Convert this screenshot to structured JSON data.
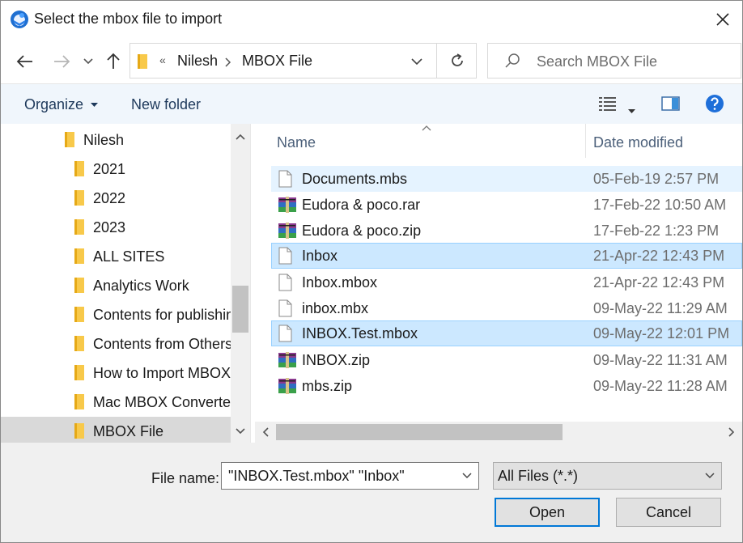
{
  "window": {
    "title": "Select the mbox file to import"
  },
  "address": {
    "overflow": "«",
    "crumbs": [
      "Nilesh",
      "MBOX File"
    ]
  },
  "search": {
    "placeholder": "Search MBOX File"
  },
  "toolbar": {
    "organize_label": "Organize",
    "new_folder_label": "New folder"
  },
  "nav_pane": {
    "items": [
      {
        "label": "Nilesh"
      },
      {
        "label": "2021"
      },
      {
        "label": "2022"
      },
      {
        "label": "2023"
      },
      {
        "label": "ALL SITES"
      },
      {
        "label": "Analytics Work"
      },
      {
        "label": "Contents for publishing"
      },
      {
        "label": "Contents from Others"
      },
      {
        "label": "How to Import MBOX"
      },
      {
        "label": "Mac MBOX Converter"
      },
      {
        "label": "MBOX File"
      }
    ]
  },
  "file_list": {
    "columns": [
      "Name",
      "Date modified"
    ],
    "rows": [
      {
        "name": "Documents.mbs",
        "date": "05-Feb-19 2:57 PM",
        "type": "file"
      },
      {
        "name": "Eudora & poco.rar",
        "date": "17-Feb-22 10:50 AM",
        "type": "archive"
      },
      {
        "name": "Eudora & poco.zip",
        "date": "17-Feb-22 1:23 PM",
        "type": "archive"
      },
      {
        "name": "Inbox",
        "date": "21-Apr-22 12:43 PM",
        "type": "file"
      },
      {
        "name": "Inbox.mbox",
        "date": "21-Apr-22 12:43 PM",
        "type": "file"
      },
      {
        "name": "inbox.mbx",
        "date": "09-May-22 11:29 AM",
        "type": "file"
      },
      {
        "name": "INBOX.Test.mbox",
        "date": "09-May-22 12:01 PM",
        "type": "file"
      },
      {
        "name": "INBOX.zip",
        "date": "09-May-22 11:31 AM",
        "type": "archive"
      },
      {
        "name": "mbs.zip",
        "date": "09-May-22 11:28 AM",
        "type": "archive"
      }
    ]
  },
  "bottom": {
    "file_name_label": "File name:",
    "file_name_value": "\"INBOX.Test.mbox\" \"Inbox\"",
    "file_type_value": "All Files (*.*)",
    "open_label": "Open",
    "cancel_label": "Cancel"
  },
  "colors": {
    "accent": "#0078d7",
    "selection": "#cce8ff",
    "hover": "#e5f3ff",
    "folder": "#f8c94a"
  }
}
